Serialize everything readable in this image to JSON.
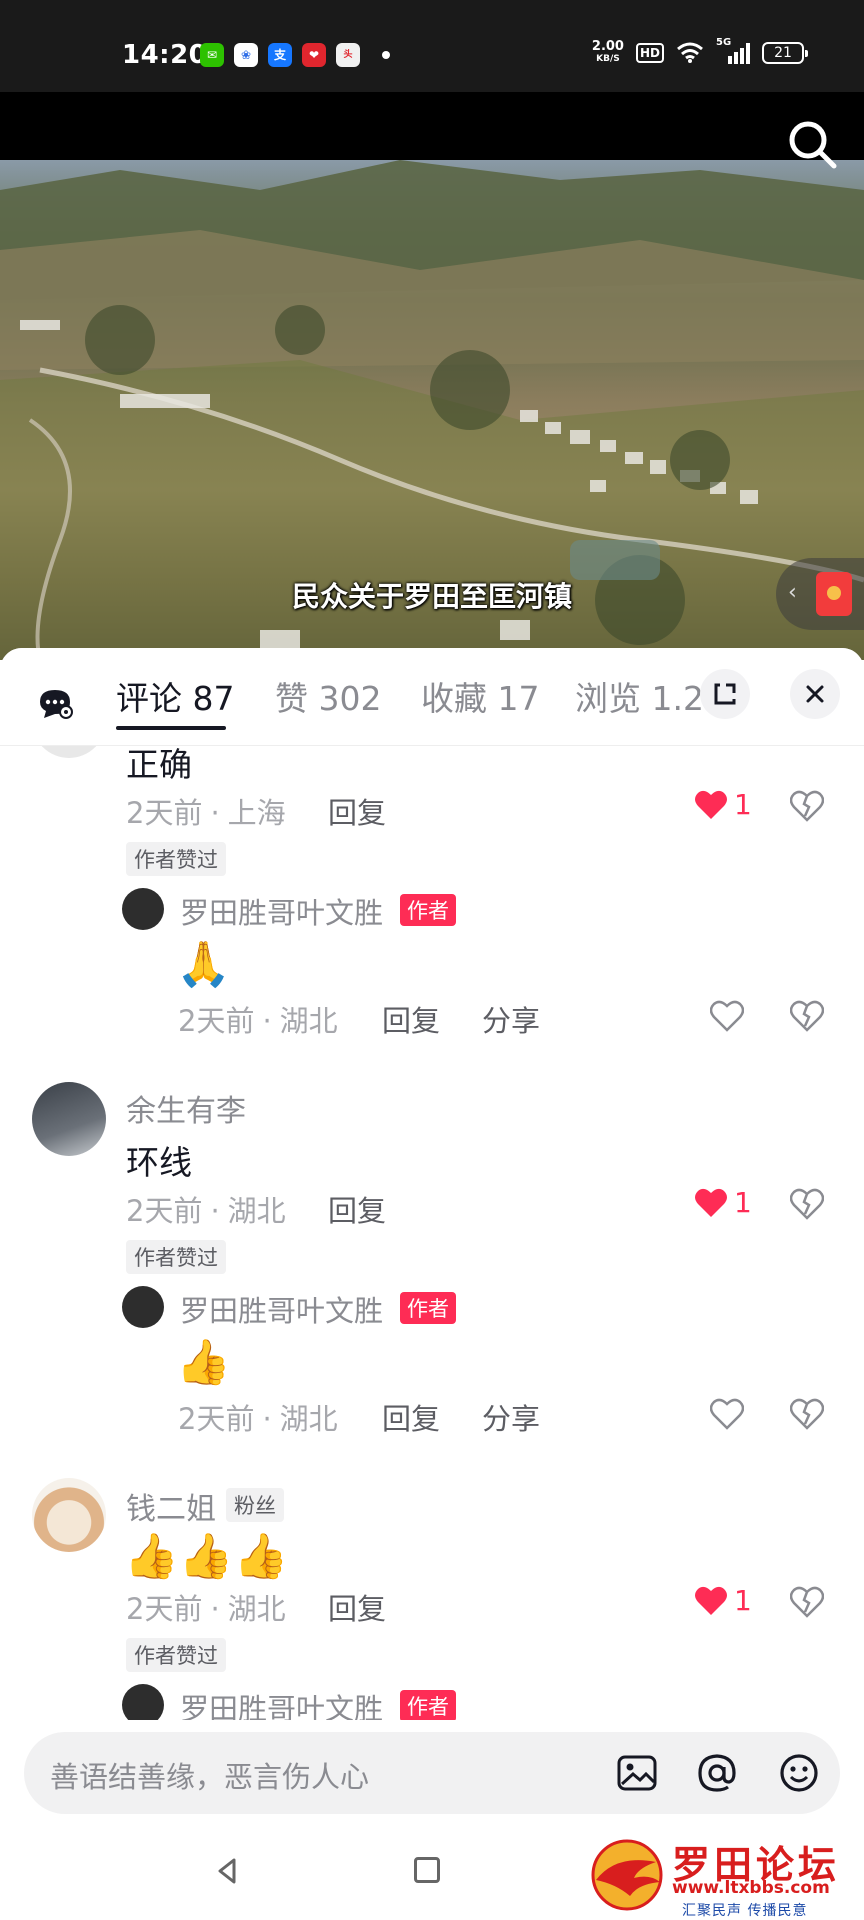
{
  "status_bar": {
    "time": "14:20",
    "app_icons": [
      "wechat-icon",
      "baidu-icon",
      "alipay-icon",
      "app-icon-red",
      "toutiao-icon"
    ],
    "net_speed_value": "2.00",
    "net_speed_unit": "KB/S",
    "hd_label": "HD",
    "network": "5G",
    "battery": "21"
  },
  "video": {
    "subtitle": "民众关于罗田至匡河镇"
  },
  "tabs": [
    {
      "label": "评论 87",
      "active": true
    },
    {
      "label": "赞 302",
      "active": false
    },
    {
      "label": "收藏 17",
      "active": false
    },
    {
      "label": "浏览 1.2",
      "active": false
    }
  ],
  "comments": [
    {
      "text": "正确",
      "time": "2天前",
      "location": "上海",
      "reply_label": "回复",
      "likes": "1",
      "liked": true,
      "author_liked_tag": "作者赞过",
      "author_reply": {
        "name": "罗田胜哥叶文胜",
        "badge": "作者",
        "content": "🙏",
        "time": "2天前",
        "location": "湖北",
        "reply_label": "回复",
        "share_label": "分享"
      }
    },
    {
      "name": "余生有李",
      "text": "环线",
      "time": "2天前",
      "location": "湖北",
      "reply_label": "回复",
      "likes": "1",
      "liked": true,
      "author_liked_tag": "作者赞过",
      "author_reply": {
        "name": "罗田胜哥叶文胜",
        "badge": "作者",
        "content": "👍",
        "time": "2天前",
        "location": "湖北",
        "reply_label": "回复",
        "share_label": "分享"
      }
    },
    {
      "name": "钱二姐",
      "fan_badge": "粉丝",
      "text": "👍👍👍",
      "time": "2天前",
      "location": "湖北",
      "reply_label": "回复",
      "likes": "1",
      "liked": true,
      "author_liked_tag": "作者赞过",
      "author_reply": {
        "name": "罗田胜哥叶文胜",
        "badge": "作者"
      }
    }
  ],
  "input": {
    "placeholder": "善语结善缘，恶言伤人心"
  },
  "watermark": {
    "title": "罗田论坛",
    "url": "www.ltxbbs.com",
    "slogan": "汇聚民声  传播民意"
  },
  "colors": {
    "accent": "#fe2c55",
    "text_primary": "#161823",
    "text_secondary": "#8a8b91",
    "watermark_red": "#d81e1e",
    "watermark_blue": "#1d4aa8"
  }
}
